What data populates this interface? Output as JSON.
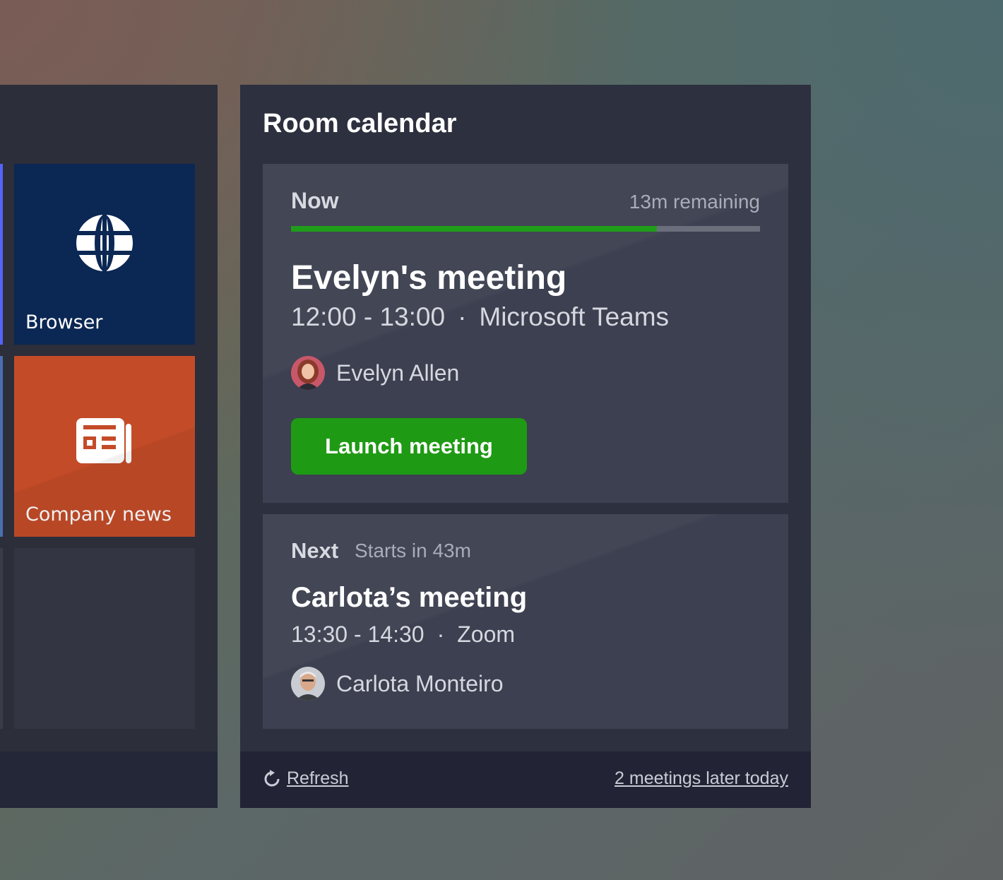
{
  "launcher": {
    "tiles": [
      {
        "label": "Browser",
        "icon": "globe-icon",
        "color": "#0b2753"
      },
      {
        "label": "Company news",
        "icon": "newspaper-icon",
        "color": "#c44b28"
      },
      {
        "label": "",
        "icon": "",
        "color": "#333543"
      }
    ],
    "accent_color": "#5563ff"
  },
  "calendar": {
    "title": "Room calendar",
    "current": {
      "status_label": "Now",
      "remaining": "13m remaining",
      "progress": 0.78,
      "title": "Evelyn's meeting",
      "time": "12:00 - 13:00",
      "separator": "·",
      "platform": "Microsoft Teams",
      "organizer": "Evelyn Allen",
      "launch_label": "Launch meeting",
      "progress_color": "#1f9d1a"
    },
    "next": {
      "status_label": "Next",
      "starts_in": "Starts in 43m",
      "title": "Carlota’s meeting",
      "time": "13:30 - 14:30",
      "separator": "·",
      "platform": "Zoom",
      "organizer": "Carlota Monteiro"
    },
    "footer": {
      "refresh_label": "Refresh",
      "later_label": "2 meetings later today"
    }
  }
}
